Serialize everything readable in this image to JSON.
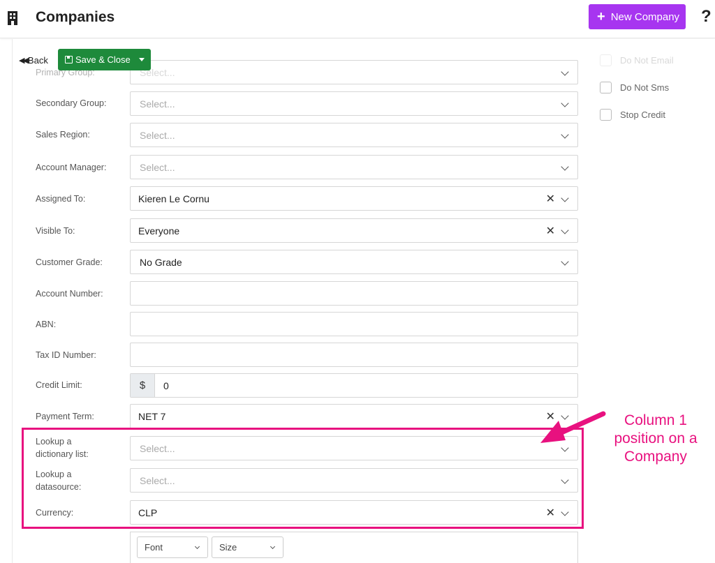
{
  "header": {
    "title": "Companies",
    "new_button_label": "New Company",
    "help_label": "?",
    "accent_color": "#a735f0"
  },
  "toolbar": {
    "back_label": "Back",
    "save_label": "Save & Close",
    "save_color": "#1e8a3b"
  },
  "form": {
    "rows": [
      {
        "label": "Primary Group:",
        "placeholder": "Select...",
        "value": ""
      },
      {
        "label": "Secondary Group:",
        "placeholder": "Select...",
        "value": ""
      },
      {
        "label": "Sales Region:",
        "placeholder": "Select...",
        "value": ""
      },
      {
        "label": "Account Manager:",
        "placeholder": "Select...",
        "value": ""
      },
      {
        "label": "Assigned To:",
        "value": "Kieren Le Cornu"
      },
      {
        "label": "Visible To:",
        "value": "Everyone"
      },
      {
        "label": "Customer Grade:",
        "value": "No Grade"
      },
      {
        "label": "Account Number:",
        "value": ""
      },
      {
        "label": "ABN:",
        "value": ""
      },
      {
        "label": "Tax ID Number:",
        "value": ""
      },
      {
        "label": "Credit Limit:",
        "addon": "$",
        "value": "0"
      },
      {
        "label": "Payment Term:",
        "value": "NET 7"
      },
      {
        "label_line1": "Lookup a",
        "label_line2": "dictionary list:",
        "placeholder": "Select..."
      },
      {
        "label_line1": "Lookup a",
        "label_line2": "datasource:",
        "placeholder": "Select..."
      },
      {
        "label": "Currency:",
        "value": "CLP"
      }
    ]
  },
  "right_panel": {
    "checkboxes": [
      {
        "label": "Do Not Email"
      },
      {
        "label": "Do Not Sms"
      },
      {
        "label": "Stop Credit"
      }
    ]
  },
  "annotation": {
    "line1": "Column 1",
    "line2": "position on a",
    "line3": "Company",
    "color": "#e8117f"
  },
  "editor": {
    "font_label": "Font",
    "size_label": "Size"
  }
}
